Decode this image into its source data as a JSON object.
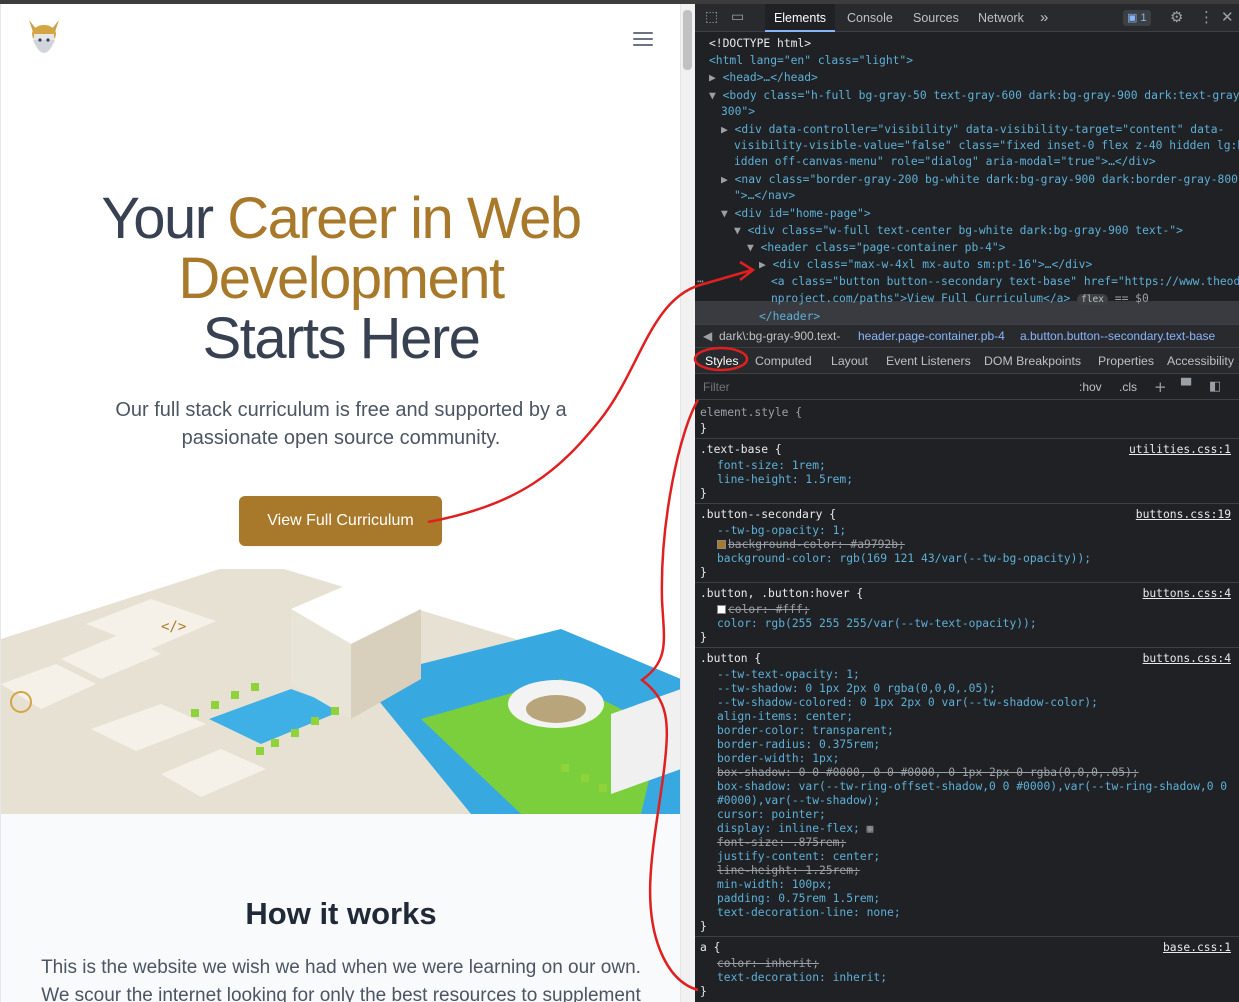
{
  "site": {
    "hero_title_1": "Your ",
    "hero_title_2": "Career in Web Development",
    "hero_title_3": "Starts Here",
    "hero_sub": "Our full stack curriculum is free and supported by a passionate open source community.",
    "cta_label": "View Full Curriculum",
    "how_title": "How it works",
    "how_text": "This is the website we wish we had when we were learning on our own. We scour the internet looking for only the best resources to supplement"
  },
  "devtools": {
    "tabs": [
      "Elements",
      "Console",
      "Sources",
      "Network"
    ],
    "more": "»",
    "issues_count": "1",
    "dom_lines": {
      "l0": "<!DOCTYPE html>",
      "l1": "<html lang=\"en\" class=\"light\">",
      "l2": "<head>…</head>",
      "l3a": "<body class=\"h-full bg-gray-50 text-gray-600 dark:bg-gray-900 dark:text-gray-",
      "l3b": "300\">",
      "l4a": "<div data-controller=\"visibility\" data-visibility-target=\"content\" data-",
      "l4b": "visibility-visible-value=\"false\" class=\"fixed inset-0 flex z-40 hidden lg:h",
      "l4c": "idden off-canvas-menu\" role=\"dialog\" aria-modal=\"true\">…</div>",
      "l5a": "<nav class=\"border-gray-200 bg-white dark:bg-gray-900 dark:border-gray-800",
      "l5b": "\">…</nav>",
      "l6": "<div id=\"home-page\">",
      "l7": "<div class=\"w-full text-center bg-white dark:bg-gray-900 text-\">",
      "l8": "<header class=\"page-container pb-4\">",
      "l9": "<div class=\"max-w-4xl mx-auto sm:pt-16\">…</div>",
      "l10a": "<a class=\"button button--secondary text-base\" href=\"https://www.theodi",
      "l10b": "nproject.com/paths\">View Full Curriculum</a>",
      "l10c": "flex",
      "l10d": "== $0",
      "l11": "</header>"
    },
    "crumbs": [
      "dark\\:bg-gray-900.text-",
      "header.page-container.pb-4",
      "a.button.button--secondary.text-base"
    ],
    "subtabs": [
      "Styles",
      "Computed",
      "Layout",
      "Event Listeners",
      "DOM Breakpoints",
      "Properties",
      "Accessibility"
    ],
    "filter_placeholder": "Filter",
    "hov": ":hov",
    "cls": ".cls",
    "rules": {
      "r0_sel": "element.style {",
      "r0_end": "}",
      "r1_sel": ".text-base {",
      "r1_src": "utilities.css:1",
      "r1_p1": "font-size: 1rem;",
      "r1_p2": "line-height: 1.5rem;",
      "r2_sel": ".button--secondary {",
      "r2_src": "buttons.css:19",
      "r2_p1": "--tw-bg-opacity: 1;",
      "r2_p2": "background-color: #a9792b;",
      "r2_p3": "background-color: rgb(169 121 43/var(--tw-bg-opacity));",
      "r3_sel": ".button, .button:hover {",
      "r3_src": "buttons.css:4",
      "r3_p1": "color: #fff;",
      "r3_p2": "color: rgb(255 255 255/var(--tw-text-opacity));",
      "r4_sel": ".button {",
      "r4_src": "buttons.css:4",
      "r4_lines": [
        "--tw-text-opacity: 1;",
        "--tw-shadow: 0 1px 2px 0 rgba(0,0,0,.05);",
        "--tw-shadow-colored: 0 1px 2px 0 var(--tw-shadow-color);",
        "align-items: center;",
        "border-color: transparent;",
        "border-radius: 0.375rem;",
        "border-width: 1px;",
        "box-shadow: 0 0 #0000, 0 0 #0000, 0 1px 2px 0 rgba(0,0,0,.05);",
        "box-shadow: var(--tw-ring-offset-shadow,0 0 #0000),var(--tw-ring-shadow,0 0",
        "    #0000),var(--tw-shadow);",
        "cursor: pointer;",
        "display: inline-flex;",
        "font-size: .875rem;",
        "justify-content: center;",
        "line-height: 1.25rem;",
        "min-width: 100px;",
        "padding: 0.75rem 1.5rem;",
        "text-decoration-line: none;"
      ],
      "r5_sel": "a {",
      "r5_src": "base.css:1",
      "r5_p1": "color: inherit;",
      "r5_p2": "text-decoration: inherit;"
    }
  },
  "colors": {
    "accent": "#a9792b",
    "heading": "#374151",
    "annotation": "#e02020"
  }
}
